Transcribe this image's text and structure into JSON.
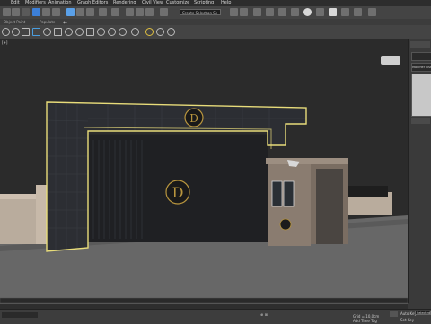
{
  "menu": [
    "Edit",
    "Modifiers",
    "Animation",
    "Graph Editors",
    "Rendering",
    "Civil View",
    "Customize",
    "Scripting",
    "Help"
  ],
  "toolbar": {
    "selection_set": "Create Selection Se"
  },
  "ribbon": {
    "object_paint": "Object Paint",
    "populate": "Populate"
  },
  "command_panel": {
    "modifier_list": "Modifier List"
  },
  "status": {
    "grid_label": "Grid = 10,0cm",
    "auto_key": "Auto Key",
    "selected": "Selected",
    "set_key": "Set Key",
    "add_time_tag": "Add Time Tag"
  },
  "colors": {
    "viewport_bg": "#2b2b2b",
    "selection_highlight": "#e8dc7a",
    "gate_frame": "#2c2e33",
    "guardhouse": "#8a7c70",
    "logo_gold": "#b8953e",
    "ground": "#6b6b6b"
  }
}
